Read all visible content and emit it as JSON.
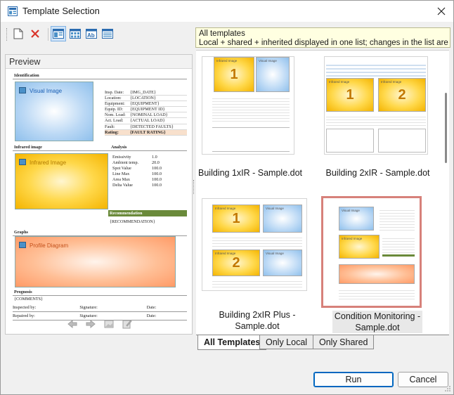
{
  "window": {
    "title": "Template Selection",
    "close_label": "×"
  },
  "toolbar": {
    "buttons": [
      {
        "name": "new-icon"
      },
      {
        "name": "delete-icon"
      },
      {
        "name": "view-preview-icon",
        "active": true
      },
      {
        "name": "view-thumbnails-icon"
      },
      {
        "name": "view-text-icon"
      },
      {
        "name": "view-details-icon"
      }
    ]
  },
  "tooltip": {
    "line1": "All templates",
    "line2": "Local + shared + inherited displayed in one list; changes in the list are not"
  },
  "preview": {
    "header": "Preview",
    "doc": {
      "identification": "Identification",
      "visual_image": "Visual Image",
      "fields": [
        {
          "k": "Insp. Date:",
          "v": "{IMG_DATE}"
        },
        {
          "k": "Location:",
          "v": "{LOCATION}"
        },
        {
          "k": "Equipment:",
          "v": "{EQUIPMENT}"
        },
        {
          "k": "Equip. ID:",
          "v": "{EQUIPMENT ID}"
        },
        {
          "k": "Nom. Load:",
          "v": "{NOMINAL LOAD}"
        },
        {
          "k": "Act. Load:",
          "v": "{ACTUAL LOAD}"
        },
        {
          "k": "Fault:",
          "v": "{DETECTED FAULTS}"
        },
        {
          "k": "Rating:",
          "v": "{FAULT RATING}",
          "hl": true
        }
      ],
      "infrared_section": "Infrared image",
      "infrared_image": "Infrared Image",
      "analysis_section": "Analysis",
      "analysis": [
        {
          "k": "Emissivity",
          "v": "1.0"
        },
        {
          "k": "Ambient temp.",
          "v": "20.0"
        },
        {
          "k": "Spot Value",
          "v": "100.0"
        },
        {
          "k": "Line Max",
          "v": "100.0"
        },
        {
          "k": "Area Max",
          "v": "100.0"
        },
        {
          "k": "Delta Value",
          "v": "100.0"
        }
      ],
      "recommendation_section": "Recommendation",
      "recommendation_value": "{RECOMMENDATION}",
      "graphs_section": "Graphs",
      "profile_diagram": "Profile Diagram",
      "prognosis_section": "Prognosis",
      "comments": "{COMMENTS}",
      "inspected_by": "Inspected by:",
      "repaired_by": "Repaired by:",
      "signature": "Signature:",
      "date": "Date:"
    }
  },
  "templates": [
    {
      "label": "Building 1xIR - Sample.dot",
      "ir_numbers": [
        "1"
      ],
      "selected": false
    },
    {
      "label": "Building 2xIR - Sample.dot",
      "ir_numbers": [
        "1",
        "2"
      ],
      "selected": false
    },
    {
      "label": "Building 2xIR Plus - Sample.dot",
      "ir_numbers": [
        "1",
        "2"
      ],
      "selected": false
    },
    {
      "label": "Condition Monitoring - Sample.dot",
      "ir_numbers": [],
      "selected": true
    }
  ],
  "thumb_text": {
    "visual_image": "Visual Image",
    "infrared_image": "Infrared Image"
  },
  "tabs": [
    {
      "label": "All Templates",
      "active": true
    },
    {
      "label": "Only Local",
      "active": false
    },
    {
      "label": "Only Shared",
      "active": false
    }
  ],
  "buttons": {
    "run": "Run",
    "cancel": "Cancel"
  },
  "colors": {
    "accent": "#0067c0",
    "selection_border": "#d7817a",
    "tooltip_bg": "#ffffe1",
    "recommendation_bar": "#6a8a3a"
  }
}
